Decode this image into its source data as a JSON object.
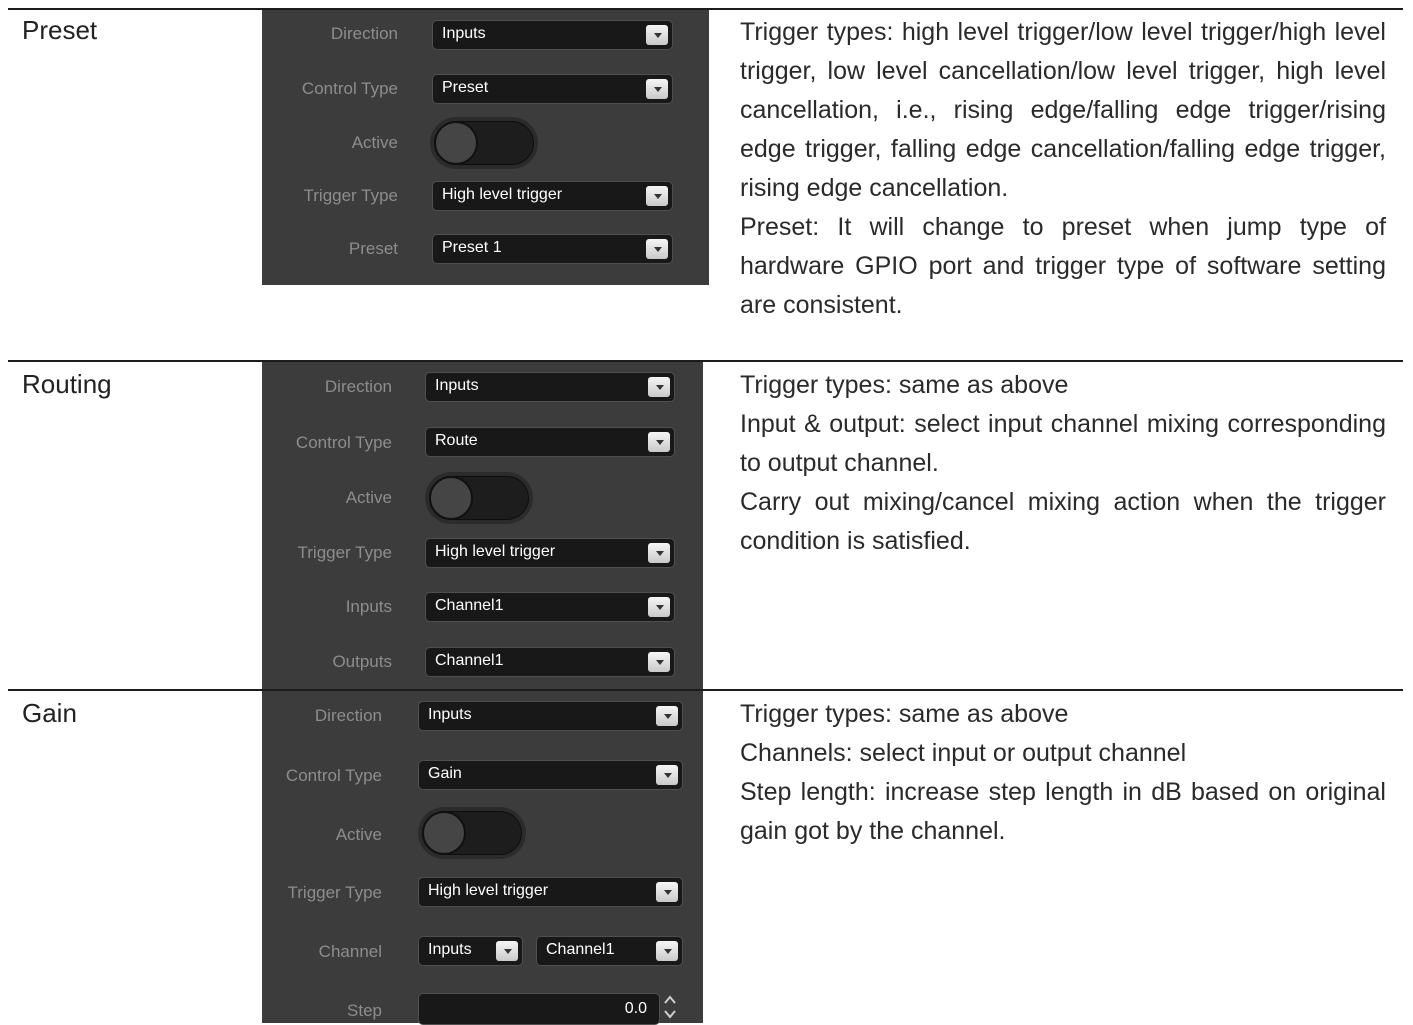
{
  "rows": [
    {
      "label": "Preset",
      "panel": {
        "fields": {
          "direction": {
            "label": "Direction",
            "value": "Inputs"
          },
          "control_type": {
            "label": "Control Type",
            "value": "Preset"
          },
          "active": {
            "label": "Active",
            "on": false
          },
          "trigger_type": {
            "label": "Trigger Type",
            "value": "High level trigger"
          },
          "preset": {
            "label": "Preset",
            "value": "Preset 1"
          }
        }
      },
      "description": [
        "Trigger types: high level trigger/low level trigger/high level trigger, low level cancellation/low level trigger, high level cancellation, i.e., rising edge/falling edge trigger/rising edge trigger, falling edge cancellation/falling edge trigger, rising edge cancellation.",
        "Preset: It will change to preset when jump type of hardware GPIO port and trigger type of software setting are consistent."
      ]
    },
    {
      "label": "Routing",
      "panel": {
        "fields": {
          "direction": {
            "label": "Direction",
            "value": "Inputs"
          },
          "control_type": {
            "label": "Control Type",
            "value": "Route"
          },
          "active": {
            "label": "Active",
            "on": false
          },
          "trigger_type": {
            "label": "Trigger Type",
            "value": "High level trigger"
          },
          "inputs": {
            "label": "Inputs",
            "value": "Channel1"
          },
          "outputs": {
            "label": "Outputs",
            "value": "Channel1"
          }
        }
      },
      "description": [
        "Trigger types: same as above",
        "Input & output: select input channel mixing corresponding to output channel.",
        "Carry out mixing/cancel mixing action when the trigger condition is satisfied."
      ]
    },
    {
      "label": "Gain",
      "panel": {
        "fields": {
          "direction": {
            "label": "Direction",
            "value": "Inputs"
          },
          "control_type": {
            "label": "Control Type",
            "value": "Gain"
          },
          "active": {
            "label": "Active",
            "on": false
          },
          "trigger_type": {
            "label": "Trigger Type",
            "value": "High level trigger"
          },
          "channel": {
            "label": "Channel",
            "direction_value": "Inputs",
            "channel_value": "Channel1"
          },
          "step": {
            "label": "Step",
            "value": "0.0"
          }
        }
      },
      "description": [
        "Trigger types: same as above",
        "Channels: select input or output channel",
        "Step length: increase step length in dB based on original gain got by the channel."
      ]
    }
  ],
  "colors": {
    "panel_bg": "#3c3c3c",
    "field_bg": "#181818",
    "label": "#8d8d8d",
    "rule": "#1c1c1c"
  },
  "icons": {
    "dropdown": "chevron-down-icon",
    "spinner": "up-down-arrows-icon"
  }
}
